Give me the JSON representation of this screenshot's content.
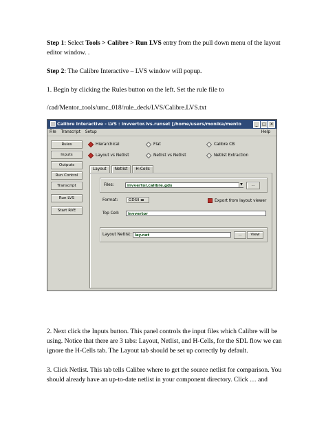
{
  "doc": {
    "step1": {
      "lead": "Step 1",
      "pre": ": Select ",
      "path": "Tools > Calibre > Run LVS",
      "post": " entry from the pull down menu of the layout editor window. ."
    },
    "step2": {
      "lead": "Step 2",
      "text": ": The Calibre Interactive – LVS window will popup."
    },
    "item1": "1. Begin by clicking the Rules button on the left. Set the rule file to",
    "rule_path": "/cad/Mentor_tools/umc_018/rule_deck/LVS/Calibre.LVS.txt",
    "item2": "2. Next click the Inputs button. This panel controls the input files which Calibre will be using. Notice that there are 3 tabs: Layout, Netlist, and H-Cells, for the SDL flow we can ignore the H-Cells tab. The Layout tab should be set up correctly by default.",
    "item3": "3. Click Netlist. This tab tells Calibre where to get the source netlist for comparison. You should already have an up-to-date netlist in your component directory. Click … and"
  },
  "window": {
    "title": "Calibre Interactive - LVS : invvertor.lvs.runset [/home/users/monika/mento",
    "buttons": {
      "min": "_",
      "max": "□",
      "close": "✕"
    },
    "menu": [
      "File",
      "Transcript",
      "Setup"
    ],
    "help": "Help",
    "side_buttons": [
      "Rules",
      "Inputs",
      "Outputs",
      "Run Control",
      "Transcript",
      "Run LVS",
      "Start RVE"
    ],
    "radio_row1": [
      "Hierarchical",
      "Flat",
      "Calibre CB"
    ],
    "radio_row2": [
      "Layout vs Netlist",
      "Netlist vs Netlist",
      "Netlist Extraction"
    ],
    "tabs": [
      "Layout",
      "Netlist",
      "H-Cells"
    ],
    "files_label": "Files:",
    "files_value": "invvertor.calibre.gds",
    "dots": "...",
    "format_label": "Format:",
    "format_value": "GDSII",
    "export_label": "Export from layout viewer",
    "topcell_label": "Top Cell:",
    "topcell_value": "invvertor",
    "netlist_label": "Layout Netlist:",
    "netlist_value": "lay.net",
    "view_label": "View"
  }
}
